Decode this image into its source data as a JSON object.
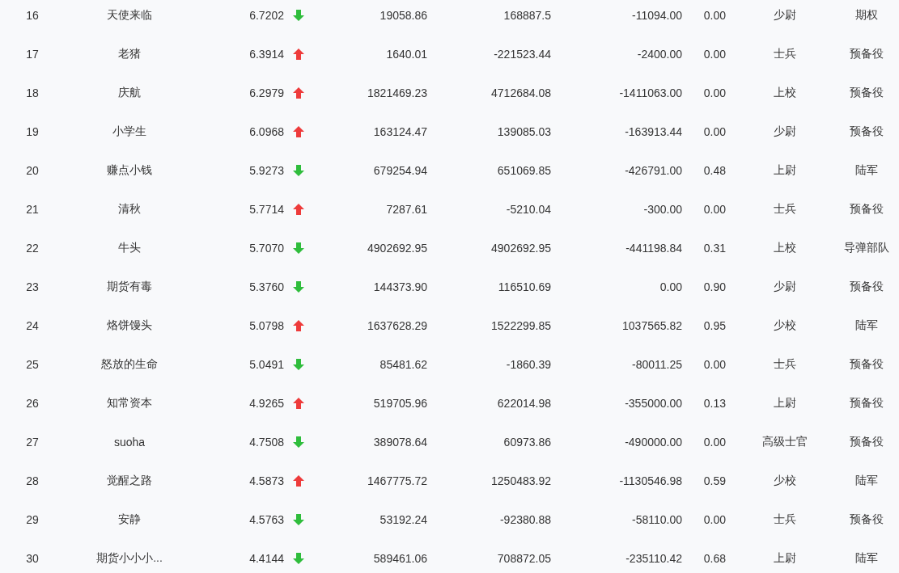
{
  "table": {
    "rows": [
      {
        "cells": [
          "16",
          "天使来临",
          "6.7202",
          "19058.86",
          "168887.5",
          "-11094.00",
          "0.00",
          "少尉",
          "期权"
        ],
        "rising": false
      },
      {
        "cells": [
          "17",
          "老猪",
          "6.3914",
          "1640.01",
          "-221523.44",
          "-2400.00",
          "0.00",
          "士兵",
          "预备役"
        ],
        "rising": true
      },
      {
        "cells": [
          "18",
          "庆航",
          "6.2979",
          "1821469.23",
          "4712684.08",
          "-1411063.00",
          "0.00",
          "上校",
          "预备役"
        ],
        "rising": true
      },
      {
        "cells": [
          "19",
          "小学生",
          "6.0968",
          "163124.47",
          "139085.03",
          "-163913.44",
          "0.00",
          "少尉",
          "预备役"
        ],
        "rising": true
      },
      {
        "cells": [
          "20",
          "赚点小钱",
          "5.9273",
          "679254.94",
          "651069.85",
          "-426791.00",
          "0.48",
          "上尉",
          "陆军"
        ],
        "rising": false
      },
      {
        "cells": [
          "21",
          "清秋",
          "5.7714",
          "7287.61",
          "-5210.04",
          "-300.00",
          "0.00",
          "士兵",
          "预备役"
        ],
        "rising": true
      },
      {
        "cells": [
          "22",
          "牛头",
          "5.7070",
          "4902692.95",
          "4902692.95",
          "-441198.84",
          "0.31",
          "上校",
          "导弹部队"
        ],
        "rising": false
      },
      {
        "cells": [
          "23",
          "期货有毒",
          "5.3760",
          "144373.90",
          "116510.69",
          "0.00",
          "0.90",
          "少尉",
          "预备役"
        ],
        "rising": false
      },
      {
        "cells": [
          "24",
          "烙饼馒头",
          "5.0798",
          "1637628.29",
          "1522299.85",
          "1037565.82",
          "0.95",
          "少校",
          "陆军"
        ],
        "rising": true
      },
      {
        "cells": [
          "25",
          "怒放的生命",
          "5.0491",
          "85481.62",
          "-1860.39",
          "-80011.25",
          "0.00",
          "士兵",
          "预备役"
        ],
        "rising": false
      },
      {
        "cells": [
          "26",
          "知常资本",
          "4.9265",
          "519705.96",
          "622014.98",
          "-355000.00",
          "0.13",
          "上尉",
          "预备役"
        ],
        "rising": true
      },
      {
        "cells": [
          "27",
          "suoha",
          "4.7508",
          "389078.64",
          "60973.86",
          "-490000.00",
          "0.00",
          "高级士官",
          "预备役"
        ],
        "rising": false
      },
      {
        "cells": [
          "28",
          "觉醒之路",
          "4.5873",
          "1467775.72",
          "1250483.92",
          "-1130546.98",
          "0.59",
          "少校",
          "陆军"
        ],
        "rising": true
      },
      {
        "cells": [
          "29",
          "安静",
          "4.5763",
          "53192.24",
          "-92380.88",
          "-58110.00",
          "0.00",
          "士兵",
          "预备役"
        ],
        "rising": false
      },
      {
        "cells": [
          "30",
          "期货小小小...",
          "4.4144",
          "589461.06",
          "708872.05",
          "-235110.42",
          "0.68",
          "上尉",
          "陆军"
        ],
        "rising": false
      }
    ]
  }
}
